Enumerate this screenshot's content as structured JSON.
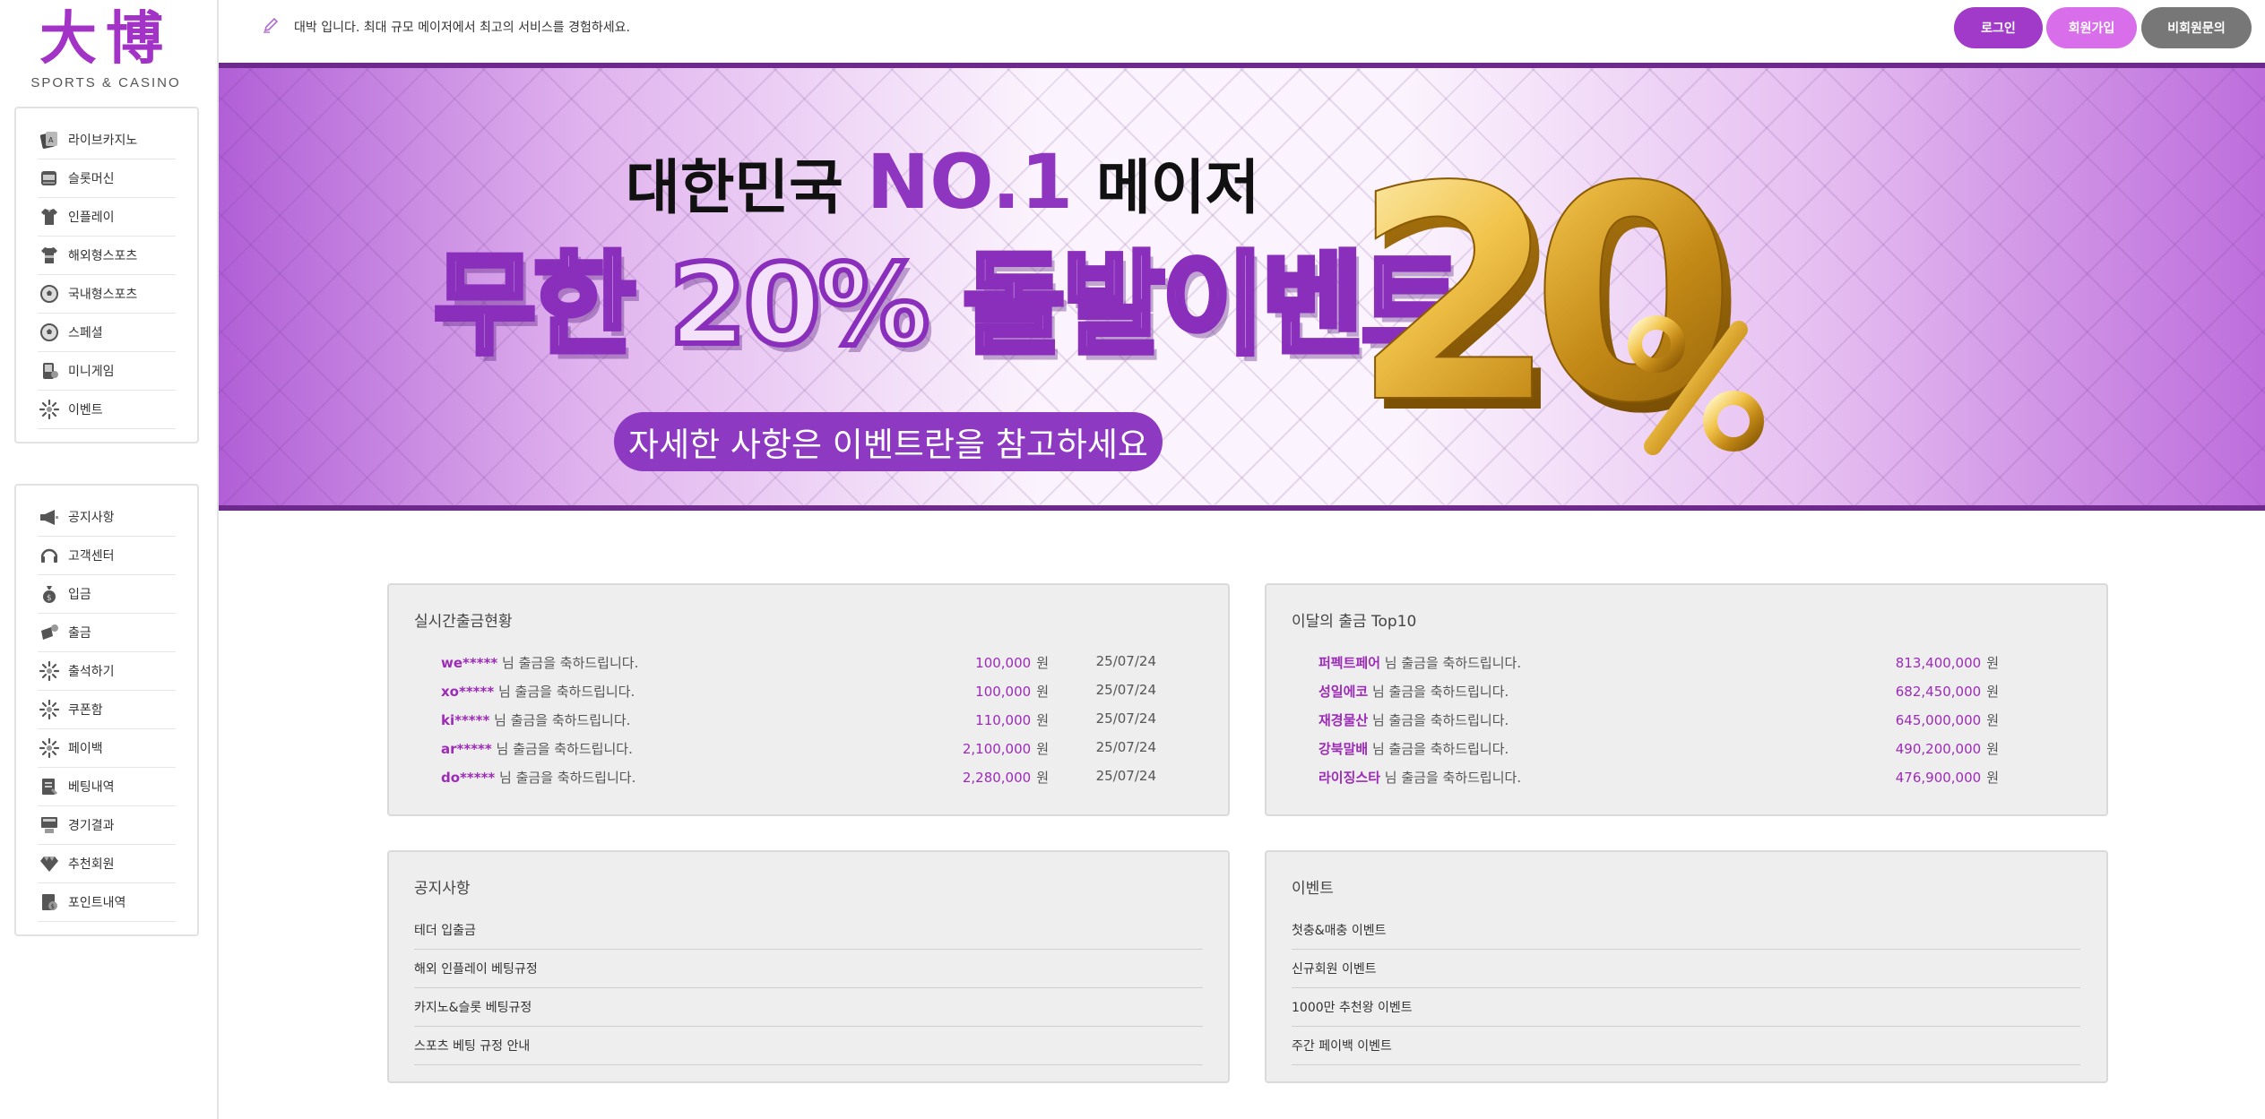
{
  "logo": {
    "main": "大博",
    "sub": "SPORTS & CASINO"
  },
  "menu_primary": [
    {
      "label": "라이브카지노",
      "icon": "casino-chip-icon"
    },
    {
      "label": "슬롯머신",
      "icon": "slot-machine-icon"
    },
    {
      "label": "인플레이",
      "icon": "jersey-icon"
    },
    {
      "label": "해외형스포츠",
      "icon": "jersey-icon"
    },
    {
      "label": "국내형스포츠",
      "icon": "soccer-ball-icon"
    },
    {
      "label": "스페셜",
      "icon": "soccer-ball-icon"
    },
    {
      "label": "미니게임",
      "icon": "mini-game-icon"
    },
    {
      "label": "이벤트",
      "icon": "starburst-icon"
    }
  ],
  "menu_secondary": [
    {
      "label": "공지사항",
      "icon": "megaphone-icon"
    },
    {
      "label": "고객센터",
      "icon": "headset-icon"
    },
    {
      "label": "입금",
      "icon": "money-bag-icon"
    },
    {
      "label": "출금",
      "icon": "withdraw-icon"
    },
    {
      "label": "출석하기",
      "icon": "starburst-icon"
    },
    {
      "label": "쿠폰함",
      "icon": "starburst-icon"
    },
    {
      "label": "페이백",
      "icon": "starburst-icon"
    },
    {
      "label": "베팅내역",
      "icon": "document-icon"
    },
    {
      "label": "경기결과",
      "icon": "scoreboard-icon"
    },
    {
      "label": "추천회원",
      "icon": "diamond-icon"
    },
    {
      "label": "포인트내역",
      "icon": "points-doc-icon"
    }
  ],
  "topbar": {
    "message": "대박 입니다. 최대 규모 메이저에서 최고의 서비스를 경험하세요.",
    "message_icon": "pencil-icon",
    "login": "로그인",
    "join": "회원가입",
    "inquiry": "비회원문의"
  },
  "banner": {
    "line1_a": "대한민국",
    "line1_b": "NO.1",
    "line1_c": "메이저",
    "line2": "무한 20% 돌발이벤트",
    "pill": "자세한 사항은 이벤트란을 참고하세요",
    "art_text": "20%"
  },
  "colors": {
    "accent": "#a13ac8",
    "accent_light": "#d86eea",
    "gray_button": "#777777",
    "banner_border": "#6d2a8c"
  },
  "withdrawals": {
    "title": "실시간출금현황",
    "suffix": "님 출금을 축하드립니다.",
    "unit": "원",
    "rows": [
      {
        "name": "we*****",
        "amount": "100,000",
        "date": "25/07/24"
      },
      {
        "name": "xo*****",
        "amount": "100,000",
        "date": "25/07/24"
      },
      {
        "name": "ki*****",
        "amount": "110,000",
        "date": "25/07/24"
      },
      {
        "name": "ar*****",
        "amount": "2,100,000",
        "date": "25/07/24"
      },
      {
        "name": "do*****",
        "amount": "2,280,000",
        "date": "25/07/24"
      }
    ]
  },
  "top10": {
    "title": "이달의 출금 Top10",
    "suffix": "님 출금을 축하드립니다.",
    "unit": "원",
    "rows": [
      {
        "name": "퍼펙트페어",
        "amount": "813,400,000"
      },
      {
        "name": "성일에코",
        "amount": "682,450,000"
      },
      {
        "name": "재경물산",
        "amount": "645,000,000"
      },
      {
        "name": "강북말배",
        "amount": "490,200,000"
      },
      {
        "name": "라이징스타",
        "amount": "476,900,000"
      }
    ]
  },
  "notices": {
    "title": "공지사항",
    "items": [
      "테더 입출금",
      "해외 인플레이 베팅규정",
      "카지노&슬롯 베팅규정",
      "스포츠 베팅 규정 안내"
    ]
  },
  "events": {
    "title": "이벤트",
    "items": [
      "첫충&매충 이벤트",
      "신규회원 이벤트",
      "1000만 추천왕 이벤트",
      "주간 페이백 이벤트"
    ]
  }
}
